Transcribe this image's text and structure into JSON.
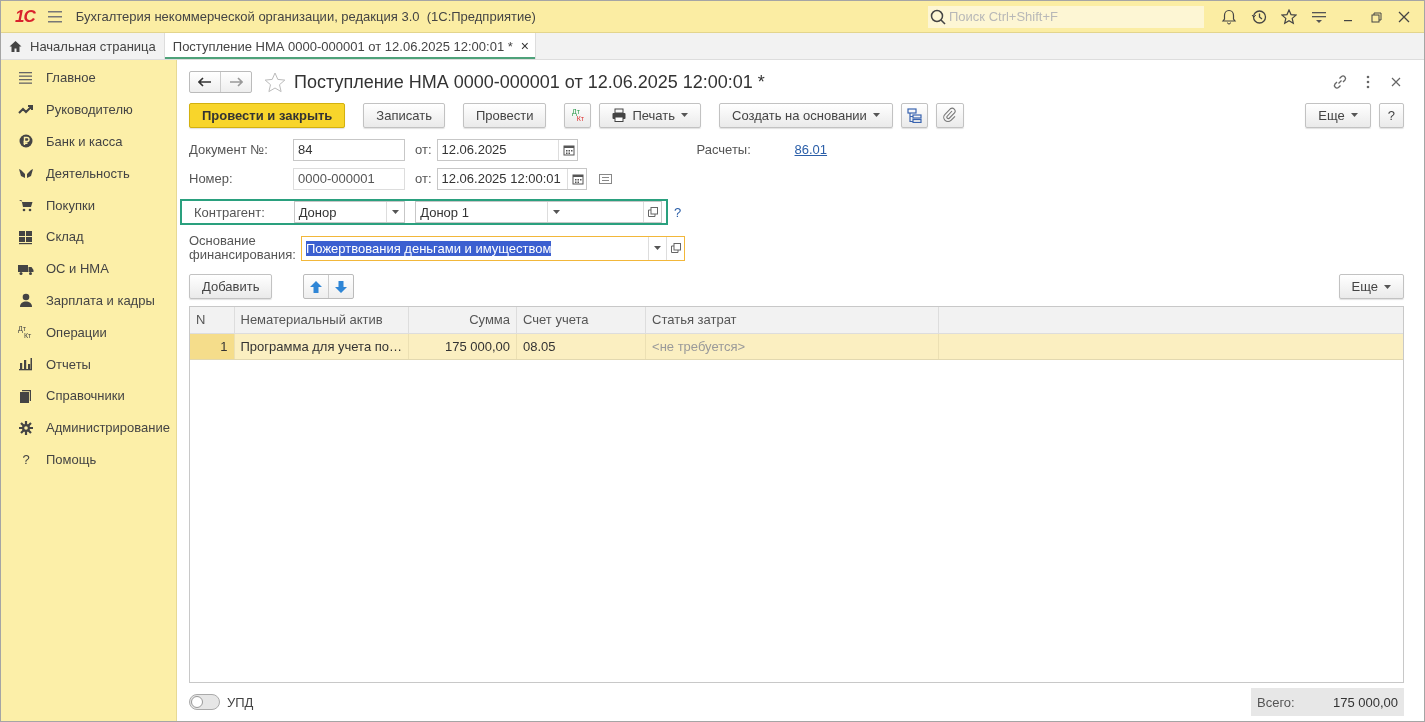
{
  "app": {
    "logo": "1С",
    "title": "Бухгалтерия некоммерческой организации, редакция 3.0  (1С:Предприятие)",
    "search": {
      "placeholder": "Поиск Ctrl+Shift+F"
    }
  },
  "tabs": [
    {
      "label": "Начальная страница",
      "selected": false,
      "kind": "home"
    },
    {
      "label": "Поступление НМА 0000-000001 от 12.06.2025 12:00:01 *",
      "selected": true,
      "kind": "document",
      "close": "×"
    }
  ],
  "sidebar": {
    "items": [
      {
        "label": "Главное"
      },
      {
        "label": "Руководителю"
      },
      {
        "label": "Банк и касса"
      },
      {
        "label": "Деятельность"
      },
      {
        "label": "Покупки"
      },
      {
        "label": "Склад"
      },
      {
        "label": "ОС и НМА"
      },
      {
        "label": "Зарплата и кадры"
      },
      {
        "label": "Операции",
        "icon_text": [
          "Дт",
          "Кт"
        ]
      },
      {
        "label": "Отчеты"
      },
      {
        "label": "Справочники"
      },
      {
        "label": "Администрирование"
      },
      {
        "label": "Помощь",
        "icon_char": "?"
      }
    ]
  },
  "form": {
    "title": "Поступление НМА 0000-000001 от 12.06.2025 12:00:01 *",
    "toolbar": [
      {
        "kind": "primary",
        "label": "Провести и закрыть"
      },
      {
        "kind": "plain",
        "label": "Записать"
      },
      {
        "kind": "plain",
        "label": "Провести"
      },
      {
        "kind": "dtkt",
        "icon_text": [
          "Дт",
          "Кт"
        ]
      },
      {
        "kind": "print",
        "label": "Печать"
      },
      {
        "kind": "menu",
        "label": "Создать на основании"
      },
      {
        "kind": "structure"
      },
      {
        "kind": "attach"
      }
    ],
    "toolbar_right": [
      {
        "kind": "menu",
        "label": "Еще"
      },
      {
        "kind": "plain",
        "label": "?"
      }
    ],
    "doc_number": {
      "label": "Документ №:",
      "value": "84",
      "date_label": "от:",
      "date": "12.06.2025"
    },
    "settlements": {
      "label": "Расчеты:",
      "link": "86.01"
    },
    "number": {
      "label": "Номер:",
      "value": "0000-000001",
      "date_label": "от:",
      "date": "12.06.2025 12:00:01"
    },
    "counterparty": {
      "label": "Контрагент:",
      "type": "Донор",
      "value": "Донор 1",
      "highlighted": true,
      "help": "?"
    },
    "funding": {
      "label": "Основание финансирования:",
      "value": "Пожертвования деньгами и имуществом",
      "focused": true,
      "text_selected": true
    },
    "table_toolbar": {
      "add": "Добавить",
      "more": "Еще"
    },
    "table": {
      "columns": [
        "N",
        "Нематериальный актив",
        "Сумма",
        "Счет учета",
        "Статья затрат"
      ],
      "rows": [
        {
          "n": "1",
          "asset": "Программа для учета по…",
          "sum": "175 000,00",
          "account": "08.05",
          "cost_item": "<не требуется>",
          "selected": true
        }
      ]
    },
    "footer": {
      "upd": {
        "label": "УПД",
        "on": false
      },
      "total_label": "Всего:",
      "total": "175 000,00"
    }
  }
}
